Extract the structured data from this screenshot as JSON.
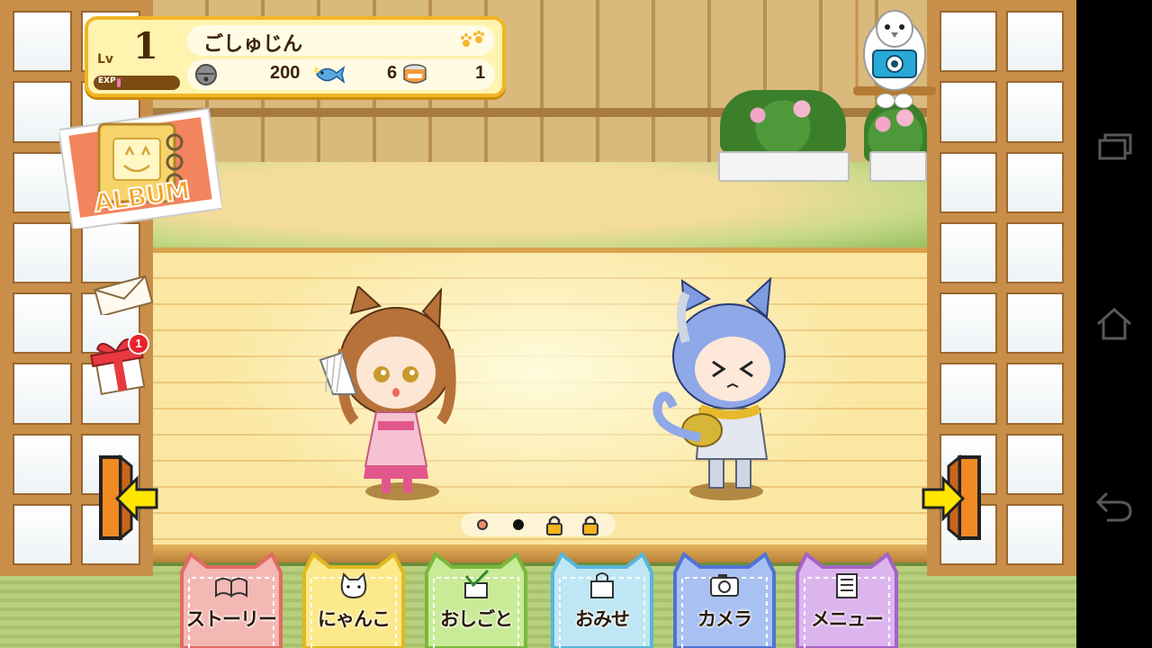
{
  "player": {
    "lv_label": "Lv",
    "level": "1",
    "exp_label": "EXP",
    "exp_progress": 0.04,
    "name": "ごしゅじん"
  },
  "currencies": {
    "bells": "200",
    "cans": "6",
    "tickets": "1"
  },
  "side": {
    "album_label": "ALBUM",
    "gift_badge": "1"
  },
  "pager": {
    "pages": [
      "visited",
      "current",
      "locked",
      "locked"
    ]
  },
  "menu": [
    {
      "label": "ストーリー",
      "icon": "book-icon",
      "color": "#f4b8b4",
      "border": "#e36a63"
    },
    {
      "label": "にゃんこ",
      "icon": "cat-face-icon",
      "color": "#fbe98a",
      "border": "#e0b820"
    },
    {
      "label": "おしごと",
      "icon": "checklist-icon",
      "color": "#c9eb98",
      "border": "#79b93c"
    },
    {
      "label": "おみせ",
      "icon": "shopping-bag-icon",
      "color": "#bfe6f5",
      "border": "#58b6d8"
    },
    {
      "label": "カメラ",
      "icon": "camera-icon",
      "color": "#a9c1f2",
      "border": "#4f74d2"
    },
    {
      "label": "メニュー",
      "icon": "list-icon",
      "color": "#dcb4ee",
      "border": "#a463c6"
    }
  ],
  "colors": {
    "status_border": "#f1b623",
    "badge": "#e8242d",
    "arrow": "#ffe600"
  }
}
